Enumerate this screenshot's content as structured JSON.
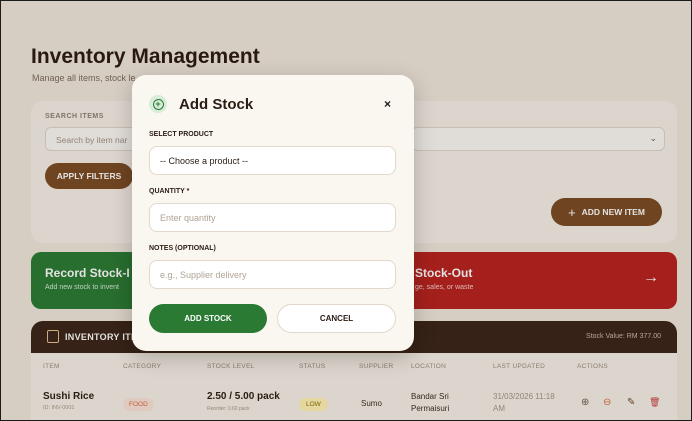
{
  "page": {
    "title": "Inventory Management",
    "subtitle": "Manage all items, stock le"
  },
  "filters": {
    "search_label": "SEARCH ITEMS",
    "search_placeholder": "Search by item nar",
    "chevron": "⌄",
    "apply_label": "APPLY FILTERS",
    "add_new_label": "ADD NEW ITEM",
    "plus_glyph": "+"
  },
  "actions": {
    "stock_in_title": "Record Stock-I",
    "stock_in_sub": "Add new stock to invent",
    "stock_out_title": "Stock-Out",
    "stock_out_sub": "ge, sales, or waste",
    "arrow_glyph": "→"
  },
  "inventory": {
    "title": "INVENTORY ITE",
    "stock_value": "Stock Value: RM 377.00",
    "columns": [
      "ITEM",
      "CATEGORY",
      "STOCK LEVEL",
      "STATUS",
      "SUPPLIER",
      "LOCATION",
      "LAST UPDATED",
      "ACTIONS"
    ],
    "rows": [
      {
        "name": "Sushi Rice",
        "id": "ID: INV-0001",
        "category": "FOOD",
        "stock": "2.50 / 5.00 pack",
        "reorder": "Reorder: 0.60 pack",
        "status": "LOW",
        "supplier": "Sumo",
        "location_line1": "Bandar Sri",
        "location_line2": "Permaisuri",
        "updated_line1": "31/03/2026 11:18",
        "updated_line2": "AM",
        "action_icons": {
          "add": "⊕",
          "remove": "⊖",
          "edit": "✎",
          "delete": "🗑"
        }
      }
    ]
  },
  "modal": {
    "title": "Add Stock",
    "close_glyph": "×",
    "icon_glyph": "+",
    "product_label": "SELECT PRODUCT",
    "product_value": "-- Choose a product --",
    "quantity_label": "QUANTITY *",
    "quantity_placeholder": "Enter quantity",
    "notes_label": "NOTES (OPTIONAL)",
    "notes_placeholder": "e.g., Supplier delivery",
    "submit_label": "ADD STOCK",
    "cancel_label": "CANCEL"
  },
  "colors": {
    "primary_brown": "#7a4a24",
    "success_green": "#2a7a34",
    "danger_red": "#b8221e",
    "header_dark": "#3a2417",
    "background": "#efe7dc"
  }
}
